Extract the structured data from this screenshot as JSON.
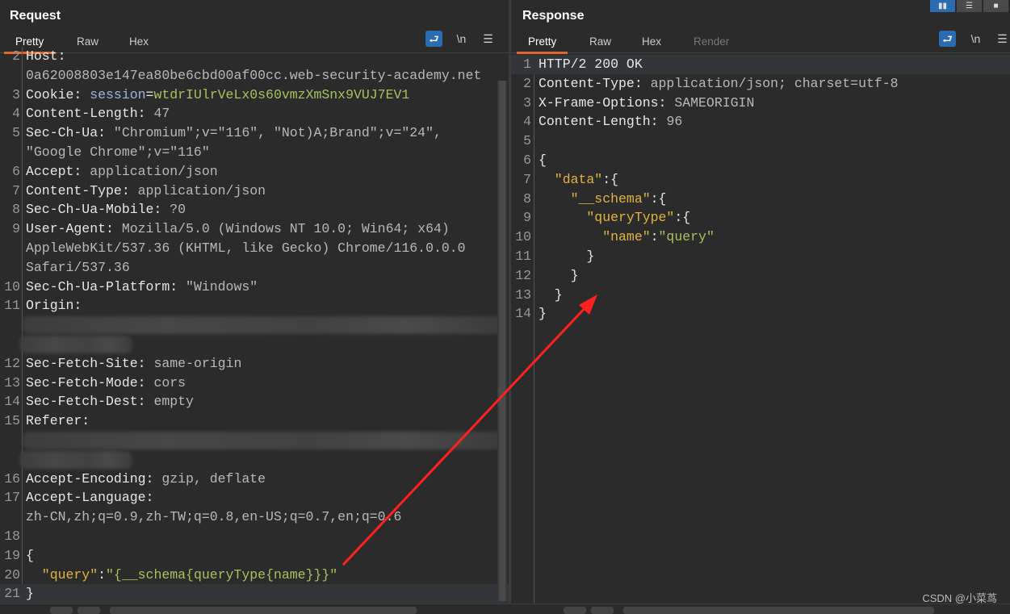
{
  "request": {
    "title": "Request",
    "tabs": [
      "Pretty",
      "Raw",
      "Hex"
    ],
    "icons": [
      "wrap-icon",
      "newline-icon",
      "menu-icon"
    ],
    "newline_label": "\\n",
    "menu_label": "☰",
    "rows": [
      {
        "n": "2",
        "parts": [
          [
            "k",
            "Host:"
          ]
        ]
      },
      {
        "parts": [
          [
            "v",
            "0a62008803e147ea80be6cbd00af00cc.web-security-academy.net"
          ]
        ]
      },
      {
        "n": "3",
        "parts": [
          [
            "k",
            "Cookie: "
          ],
          [
            "b",
            "session"
          ],
          [
            "k",
            "="
          ],
          [
            "g",
            "wtdrIUlrVeLx0s60vmzXmSnx9VUJ7EV1"
          ]
        ]
      },
      {
        "n": "4",
        "parts": [
          [
            "k",
            "Content-Length: "
          ],
          [
            "v",
            "47"
          ]
        ]
      },
      {
        "n": "5",
        "parts": [
          [
            "k",
            "Sec-Ch-Ua: "
          ],
          [
            "v",
            "\"Chromium\";v=\"116\", \"Not)A;Brand\";v=\"24\","
          ]
        ]
      },
      {
        "parts": [
          [
            "v",
            "\"Google Chrome\";v=\"116\""
          ]
        ]
      },
      {
        "n": "6",
        "parts": [
          [
            "k",
            "Accept: "
          ],
          [
            "v",
            "application/json"
          ]
        ]
      },
      {
        "n": "7",
        "parts": [
          [
            "k",
            "Content-Type: "
          ],
          [
            "v",
            "application/json"
          ]
        ]
      },
      {
        "n": "8",
        "parts": [
          [
            "k",
            "Sec-Ch-Ua-Mobile: "
          ],
          [
            "v",
            "?0"
          ]
        ]
      },
      {
        "n": "9",
        "parts": [
          [
            "k",
            "User-Agent: "
          ],
          [
            "v",
            "Mozilla/5.0 (Windows NT 10.0; Win64; x64)"
          ]
        ]
      },
      {
        "parts": [
          [
            "v",
            "AppleWebKit/537.36 (KHTML, like Gecko) Chrome/116.0.0.0"
          ]
        ]
      },
      {
        "parts": [
          [
            "v",
            "Safari/537.36"
          ]
        ]
      },
      {
        "n": "10",
        "parts": [
          [
            "k",
            "Sec-Ch-Ua-Platform: "
          ],
          [
            "v",
            "\"Windows\""
          ]
        ]
      },
      {
        "n": "11",
        "parts": [
          [
            "k",
            "Origin:"
          ]
        ]
      },
      {
        "blur": "wide",
        "parts": []
      },
      {
        "blur": "short",
        "parts": []
      },
      {
        "n": "12",
        "parts": [
          [
            "k",
            "Sec-Fetch-Site: "
          ],
          [
            "v",
            "same-origin"
          ]
        ]
      },
      {
        "n": "13",
        "parts": [
          [
            "k",
            "Sec-Fetch-Mode: "
          ],
          [
            "v",
            "cors"
          ]
        ]
      },
      {
        "n": "14",
        "parts": [
          [
            "k",
            "Sec-Fetch-Dest: "
          ],
          [
            "v",
            "empty"
          ]
        ]
      },
      {
        "n": "15",
        "parts": [
          [
            "k",
            "Referer:"
          ]
        ]
      },
      {
        "blur": "wide",
        "parts": []
      },
      {
        "blur": "short",
        "parts": []
      },
      {
        "n": "16",
        "parts": [
          [
            "k",
            "Accept-Encoding: "
          ],
          [
            "v",
            "gzip, deflate"
          ]
        ]
      },
      {
        "n": "17",
        "parts": [
          [
            "k",
            "Accept-Language: "
          ]
        ]
      },
      {
        "parts": [
          [
            "v",
            "zh-CN,zh;q=0.9,zh-TW;q=0.8,en-US;q=0.7,en;q=0.6"
          ]
        ]
      },
      {
        "n": "18",
        "parts": []
      },
      {
        "n": "19",
        "parts": [
          [
            "k",
            "{"
          ]
        ]
      },
      {
        "n": "20",
        "parts": [
          [
            "y",
            "  \"query\""
          ],
          [
            "k",
            ":"
          ],
          [
            "g",
            "\"{__schema{queryType{name}}}\""
          ]
        ]
      },
      {
        "n": "21",
        "hl": true,
        "parts": [
          [
            "k",
            "}"
          ]
        ]
      }
    ]
  },
  "response": {
    "title": "Response",
    "tabs": [
      "Pretty",
      "Raw",
      "Hex",
      "Render"
    ],
    "icons": [
      "wrap-icon",
      "newline-icon",
      "menu-icon"
    ],
    "newline_label": "\\n",
    "menu_label": "☰",
    "rows": [
      {
        "n": "1",
        "hl": true,
        "parts": [
          [
            "k",
            "HTTP/2 200 OK"
          ]
        ]
      },
      {
        "n": "2",
        "parts": [
          [
            "k",
            "Content-Type: "
          ],
          [
            "v",
            "application/json; charset=utf-8"
          ]
        ]
      },
      {
        "n": "3",
        "parts": [
          [
            "k",
            "X-Frame-Options: "
          ],
          [
            "v",
            "SAMEORIGIN"
          ]
        ]
      },
      {
        "n": "4",
        "parts": [
          [
            "k",
            "Content-Length: "
          ],
          [
            "v",
            "96"
          ]
        ]
      },
      {
        "n": "5",
        "parts": []
      },
      {
        "n": "6",
        "parts": [
          [
            "k",
            "{"
          ]
        ]
      },
      {
        "n": "7",
        "parts": [
          [
            "y",
            "  \"data\""
          ],
          [
            "k",
            ":{"
          ]
        ]
      },
      {
        "n": "8",
        "parts": [
          [
            "y",
            "    \"__schema\""
          ],
          [
            "k",
            ":{"
          ]
        ]
      },
      {
        "n": "9",
        "parts": [
          [
            "y",
            "      \"queryType\""
          ],
          [
            "k",
            ":{"
          ]
        ]
      },
      {
        "n": "10",
        "parts": [
          [
            "y",
            "        \"name\""
          ],
          [
            "k",
            ":"
          ],
          [
            "g",
            "\"query\""
          ]
        ]
      },
      {
        "n": "11",
        "parts": [
          [
            "k",
            "      }"
          ]
        ]
      },
      {
        "n": "12",
        "parts": [
          [
            "k",
            "    }"
          ]
        ]
      },
      {
        "n": "13",
        "parts": [
          [
            "k",
            "  }"
          ]
        ]
      },
      {
        "n": "14",
        "parts": [
          [
            "k",
            "}"
          ]
        ]
      }
    ]
  },
  "layout_buttons": [
    "split-horizontal-icon",
    "split-vertical-icon",
    "single-pane-icon"
  ],
  "watermark": "CSDN @小菜茑",
  "colors": {
    "accent_tab": "#e0672d",
    "active_icon": "#2b6cb0",
    "key": "#e3b341",
    "string": "#a5c25c",
    "annotation_arrow": "#ff2020"
  }
}
